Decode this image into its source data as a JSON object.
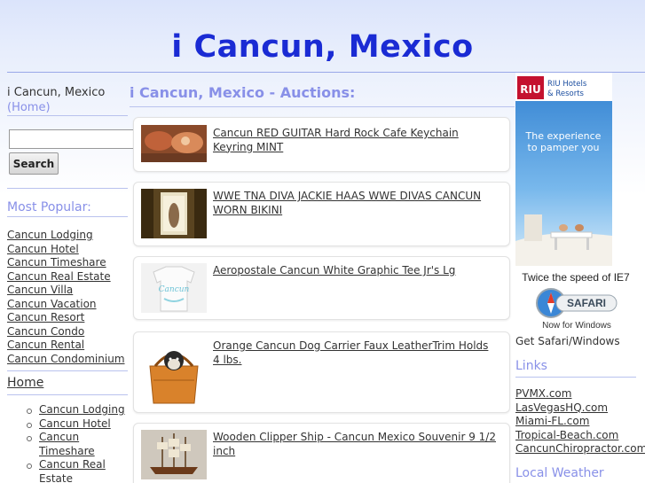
{
  "header": {
    "title": "i Cancun, Mexico"
  },
  "sidebar": {
    "site_name": "i Cancun, Mexico",
    "home_link": "(Home)",
    "search": {
      "value": "",
      "button_label": "Search"
    },
    "popular_heading": "Most Popular:",
    "popular_links": [
      "Cancun Lodging",
      "Cancun Hotel",
      "Cancun Timeshare",
      "Cancun Real Estate",
      "Cancun Villa",
      "Cancun Vacation",
      "Cancun Resort",
      "Cancun Condo",
      "Cancun Rental",
      "Cancun Condominium"
    ],
    "home_heading": "Home",
    "home_links": [
      "Cancun Lodging",
      "Cancun Hotel",
      "Cancun Timeshare",
      "Cancun Real Estate"
    ]
  },
  "main": {
    "heading": "i Cancun, Mexico - Auctions:",
    "auctions": [
      {
        "title": "Cancun RED GUITAR Hard Rock Cafe Keychain Keyring MINT"
      },
      {
        "title": "WWE TNA DIVA JACKIE HAAS WWE DIVAS CANCUN WORN BIKINI"
      },
      {
        "title": "Aeropostale Cancun White Graphic Tee Jr's Lg"
      },
      {
        "title": "Orange Cancun Dog Carrier Faux LeatherTrim Holds 4 lbs."
      },
      {
        "title": "Wooden Clipper Ship - Cancun Mexico Souvenir 9 1/2 inch"
      }
    ]
  },
  "right": {
    "riu_ad": {
      "brand": "RIU",
      "brand_line1": "RIU Hotels",
      "brand_line2": "& Resorts",
      "tagline_line1": "The experience",
      "tagline_line2": "to pamper you"
    },
    "safari_ad": {
      "headline": "Twice the speed of IE7",
      "button": "SAFARI",
      "subline": "Now for Windows"
    },
    "get_safari": "Get Safari/Windows",
    "links_heading": "Links",
    "links": [
      "PVMX.com",
      "LasVegasHQ.com",
      "Miami-FL.com",
      "Tropical-Beach.com",
      "CancunChiropractor.com"
    ],
    "weather_heading": "Local Weather"
  },
  "colors": {
    "title_blue": "#1a2bd4",
    "heading_lavender": "#8890e8",
    "riu_red": "#c4122f",
    "riu_blue": "#1d4fa0"
  }
}
